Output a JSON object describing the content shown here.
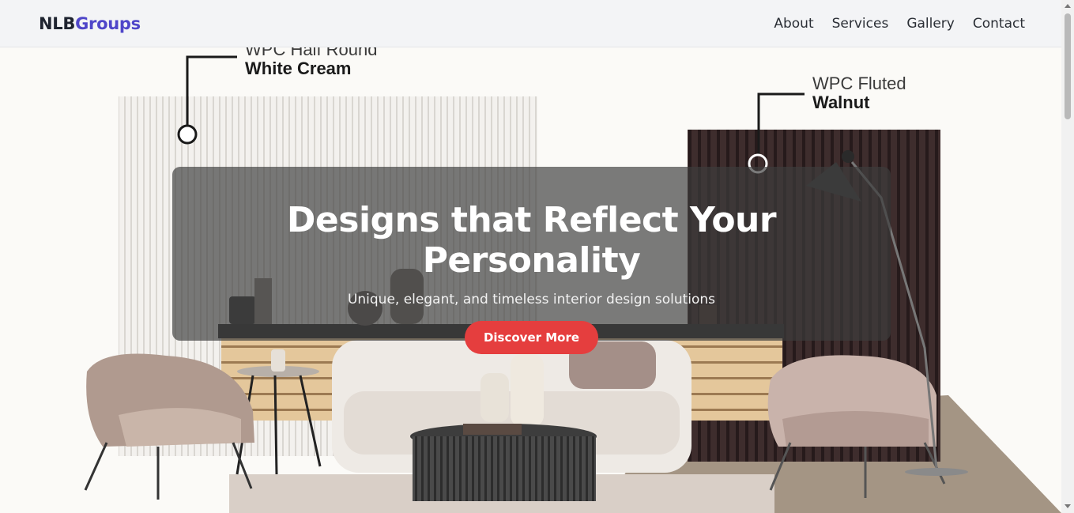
{
  "brand": {
    "part1": "NLB",
    "part2": "Groups",
    "color1": "#1f2430",
    "color2": "#4f46c9"
  },
  "nav": {
    "items": [
      {
        "label": "About"
      },
      {
        "label": "Services"
      },
      {
        "label": "Gallery"
      },
      {
        "label": "Contact"
      }
    ]
  },
  "hero": {
    "title": "Designs that Reflect Your Personality",
    "subtitle": "Unique, elegant, and timeless interior design solutions",
    "cta_label": "Discover More",
    "cta_color": "#e53e3e",
    "image_labels": [
      {
        "line1": "WPC Half Round",
        "line2": "White Cream"
      },
      {
        "line1": "WPC Fluted",
        "line2": "Walnut"
      }
    ]
  }
}
